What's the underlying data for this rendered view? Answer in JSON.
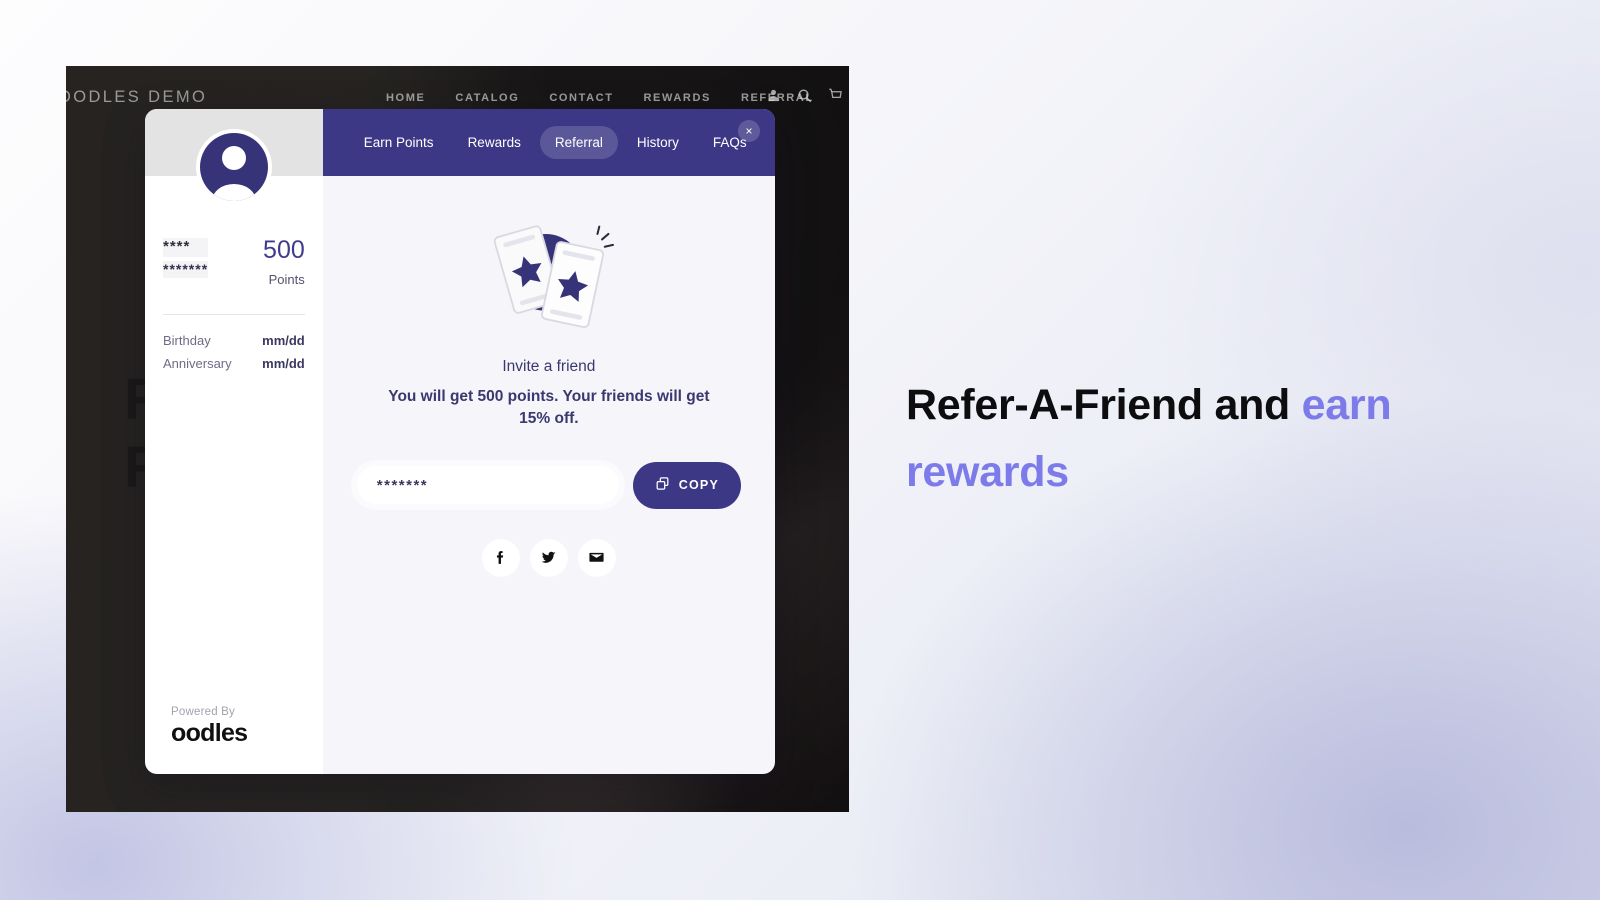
{
  "store": {
    "logo": "OODLES DEMO",
    "nav": [
      "HOME",
      "CATALOG",
      "CONTACT",
      "REWARDS",
      "REFERRAL"
    ],
    "icons": [
      "user-icon",
      "search-icon",
      "cart-icon"
    ],
    "hero_headline_line1": "R",
    "hero_headline_line2": "Re"
  },
  "widget": {
    "profile": {
      "avatar": "user-avatar-icon",
      "name_masked": "****",
      "subtitle_masked": "*******",
      "points_value": "500",
      "points_label": "Points",
      "fields": [
        {
          "label": "Birthday",
          "value": "mm/dd"
        },
        {
          "label": "Anniversary",
          "value": "mm/dd"
        }
      ]
    },
    "powered": {
      "label": "Powered By",
      "brand": "oodles"
    },
    "tabs": [
      {
        "label": "Earn Points",
        "active": false
      },
      {
        "label": "Rewards",
        "active": false
      },
      {
        "label": "Referral",
        "active": true
      },
      {
        "label": "History",
        "active": false
      },
      {
        "label": "FAQs",
        "active": false
      }
    ],
    "close_label": "×",
    "referral": {
      "illustration": "tickets-with-stars-illustration",
      "title": "Invite a friend",
      "description": "You will get 500 points. Your friends will get 15% off.",
      "code_value": "*******",
      "copy_label": "COPY",
      "copy_icon": "copy-icon",
      "share": [
        {
          "name": "facebook-icon"
        },
        {
          "name": "twitter-icon"
        },
        {
          "name": "email-icon"
        }
      ]
    }
  },
  "marketing": {
    "headline_plain": "Refer-A-Friend and ",
    "headline_accent": "earn rewards"
  },
  "colors": {
    "brand_navy": "#3c3886",
    "accent_periwinkle": "#7d7bea",
    "panel_bg": "#f5f5fa"
  }
}
